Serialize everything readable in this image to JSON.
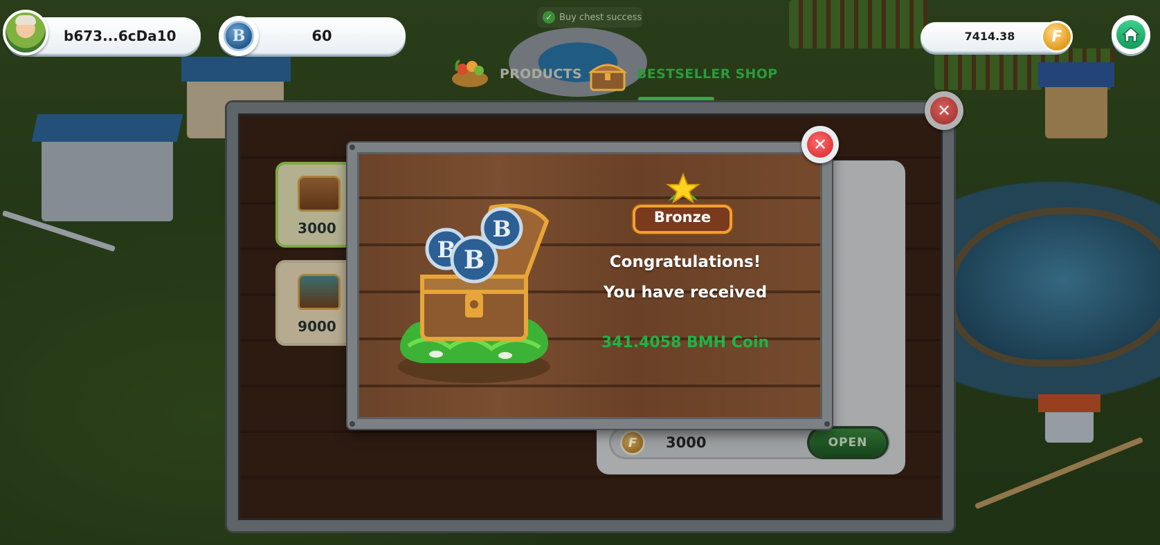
{
  "toast": {
    "text": "Buy chest success"
  },
  "user": {
    "address": "b673...6cDa10"
  },
  "balances": {
    "b_token": {
      "icon_letter": "B",
      "value": "60"
    },
    "f_token": {
      "icon_letter": "F",
      "value": "7414.38"
    }
  },
  "tabs": [
    {
      "label": "PRODUCTS",
      "active": false
    },
    {
      "label": "BESTSELLER SHOP",
      "active": true
    }
  ],
  "shop": {
    "chests": [
      {
        "price": "3000",
        "selected": true
      },
      {
        "price": "9000",
        "selected": false
      }
    ],
    "detail": {
      "price": "3000",
      "coin_letter": "F",
      "open_label": "OPEN"
    }
  },
  "modal": {
    "tier": "Bronze",
    "line1": "Congratulations!",
    "line2": "You have received",
    "reward": "341.4058 BMH Coin",
    "coin_letter": "B"
  },
  "colors": {
    "accent_green": "#35a847",
    "reward_green": "#1fb347",
    "close_red": "#d3242a",
    "badge_gold": "#f0a132"
  }
}
